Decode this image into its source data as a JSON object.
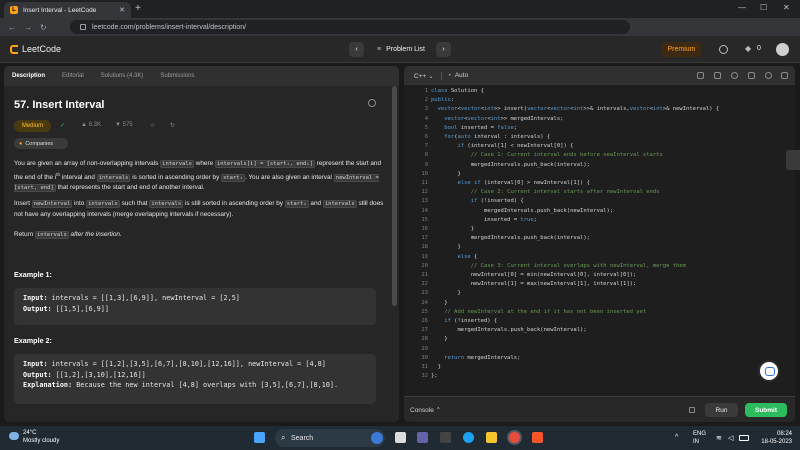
{
  "browser": {
    "tab_title": "Insert Interval - LeetCode",
    "url": "leetcode.com/problems/insert-interval/description/"
  },
  "header": {
    "logo_text": "LeetCode",
    "problem_list_label": "Problem List",
    "premium_label": "Premium",
    "streak_count": "0"
  },
  "left_tabs": [
    "Description",
    "Editorial",
    "Solutions (4.3K)",
    "Submissions"
  ],
  "problem": {
    "title": "57. Insert Interval",
    "difficulty": "Medium",
    "likes": "8.3K",
    "dislikes": "575",
    "companies_label": "Companies",
    "p1_a": "You are given an array of non-overlapping intervals ",
    "p1_code1": "intervals",
    "p1_b": " where ",
    "p1_code2": "intervals[i] = [startᵢ, endᵢ]",
    "p1_c": " represent the start and the end of the ",
    "p1_sup": "i",
    "p1_supth": "th",
    "p1_d": " interval and ",
    "p1_code3": "intervals",
    "p1_e": " is sorted in ascending order by ",
    "p1_code4": "startᵢ",
    "p1_f": ". You are also given an interval ",
    "p1_code5": "newInterval = [start, end]",
    "p1_g": " that represents the start and end of another interval.",
    "p2_a": "Insert ",
    "p2_code1": "newInterval",
    "p2_b": " into ",
    "p2_code2": "intervals",
    "p2_c": " such that ",
    "p2_code3": "intervals",
    "p2_d": " is still sorted in ascending order by ",
    "p2_code4": "startᵢ",
    "p2_e": " and ",
    "p2_code5": "intervals",
    "p2_f": " still does not have any overlapping intervals (merge overlapping intervals if necessary).",
    "p3_a": "Return ",
    "p3_code": "intervals",
    "p3_b": " after the insertion.",
    "ex1_title": "Example 1:",
    "ex1_input_label": "Input:",
    "ex1_input": " intervals = [[1,3],[6,9]], newInterval = [2,5]",
    "ex1_output_label": "Output:",
    "ex1_output": " [[1,5],[6,9]]",
    "ex2_title": "Example 2:",
    "ex2_input_label": "Input:",
    "ex2_input": " intervals = [[1,2],[3,5],[6,7],[8,10],[12,16]], newInterval = [4,8]",
    "ex2_output_label": "Output:",
    "ex2_output": " [[1,2],[3,10],[12,16]]",
    "ex2_expl_label": "Explanation:",
    "ex2_expl": " Because the new interval [4,8] overlaps with [3,5],[6,7],[8,10]."
  },
  "editor": {
    "language": "C++",
    "mode": "Auto",
    "lines": [
      "class Solution {",
      "public:",
      "  vector<vector<int>> insert(vector<vector<int>>& intervals,vector<int>& newInterval) {",
      "    vector<vector<int>> mergedIntervals;",
      "    bool inserted = false;",
      "    for(auto interval : intervals) {",
      "        if (interval[1] < newInterval[0]) {",
      "            // Case 1: Current interval ends before newInterval starts",
      "            mergedIntervals.push_back(interval);",
      "        }",
      "        else if (interval[0] > newInterval[1]) {",
      "            // Case 2: Current interval starts after newInterval ends",
      "            if (!inserted) {",
      "                mergedIntervals.push_back(newInterval);",
      "                inserted = true;",
      "            }",
      "            mergedIntervals.push_back(interval);",
      "        }",
      "        else {",
      "            // Case 3: Current interval overlaps with newInterval, merge them",
      "            newInterval[0] = min(newInterval[0], interval[0]);",
      "            newInterval[1] = max(newInterval[1], interval[1]);",
      "        }",
      "    }",
      "    // Add newInterval at the end if it has not been inserted yet",
      "    if (!inserted) {",
      "        mergedIntervals.push_back(newInterval);",
      "    }",
      "",
      "    return mergedIntervals;",
      "  }",
      "};"
    ],
    "console_label": "Console",
    "run_label": "Run",
    "submit_label": "Submit"
  },
  "taskbar": {
    "temperature": "24°C",
    "weather": "Mostly cloudy",
    "search_label": "Search",
    "lang_top": "ENG",
    "lang_bottom": "IN",
    "time": "08:24",
    "date": "18-05-2023"
  },
  "colors": {
    "accent": "#ffa116",
    "submit": "#2cbb5d",
    "medium": "#ffc01e",
    "keyword": "#569cd6",
    "comment": "#6a9955"
  },
  "icons": [
    "leetcode-logo",
    "timer-icon",
    "fire-icon",
    "search-icon",
    "chrome-icon",
    "brave-icon",
    "wifi-icon",
    "volume-icon",
    "battery-icon"
  ]
}
